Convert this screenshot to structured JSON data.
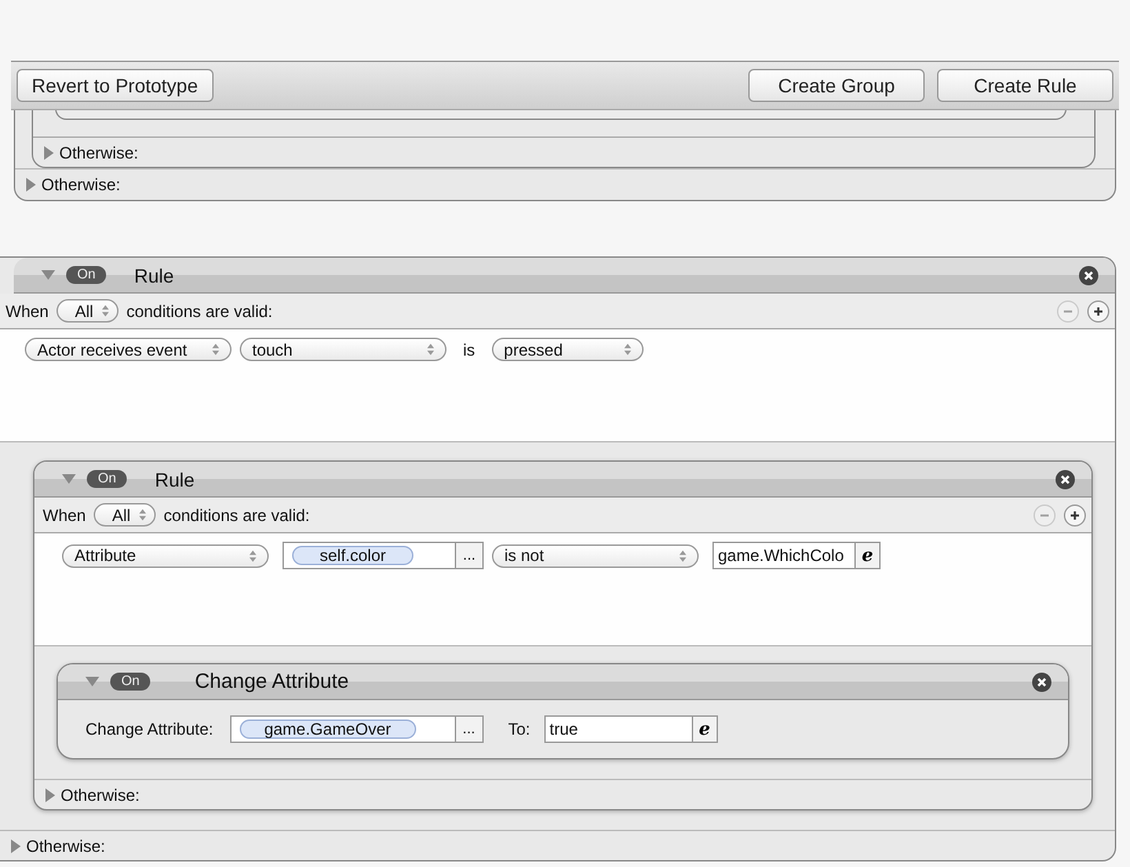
{
  "toolbar": {
    "left_buttons": [
      {
        "label": "Revert to Prototype"
      }
    ],
    "right_buttons": [
      {
        "label": "Create Group"
      },
      {
        "label": "Create Rule"
      }
    ]
  },
  "upper": {
    "inner_otherwise": {
      "label": "Otherwise:",
      "expanded": false
    },
    "outer_otherwise": {
      "label": "Otherwise:",
      "expanded": false
    }
  },
  "rule": {
    "expanded": true,
    "switch": {
      "label": "On",
      "on": true
    },
    "title": "Rule",
    "when": {
      "prefix": "When",
      "mode": "All",
      "suffix": "conditions are valid:",
      "remove_disabled": true
    },
    "conditions": [
      [
        {
          "kind": "select",
          "text": "Actor receives event"
        },
        {
          "kind": "select",
          "text": "touch"
        },
        {
          "kind": "word",
          "text": "is"
        },
        {
          "kind": "select",
          "text": "pressed"
        }
      ]
    ],
    "children": [
      {
        "kind": "rule",
        "expanded": true,
        "switch": {
          "label": "On",
          "on": true
        },
        "title": "Rule",
        "when": {
          "prefix": "When",
          "mode": "All",
          "suffix": "conditions are valid:",
          "remove_disabled": true
        },
        "conditions": [
          [
            {
              "kind": "select",
              "text": "Attribute"
            },
            {
              "kind": "chip",
              "text": "self.color",
              "button": "..."
            },
            {
              "kind": "select",
              "text": "is not"
            },
            {
              "kind": "expression",
              "text": "game.WhichColo",
              "editor": "e"
            }
          ]
        ],
        "children": [
          {
            "kind": "action",
            "expanded": true,
            "switch": {
              "label": "On",
              "on": true
            },
            "title": "Change Attribute",
            "field_label": "Change Attribute:",
            "attribute": {
              "text": "game.GameOver",
              "button": "..."
            },
            "to_label": "To:",
            "value": {
              "text": "true",
              "editor": "e"
            }
          }
        ],
        "otherwise": {
          "label": "Otherwise:",
          "expanded": false
        }
      }
    ],
    "otherwise": {
      "label": "Otherwise:",
      "expanded": false
    }
  }
}
